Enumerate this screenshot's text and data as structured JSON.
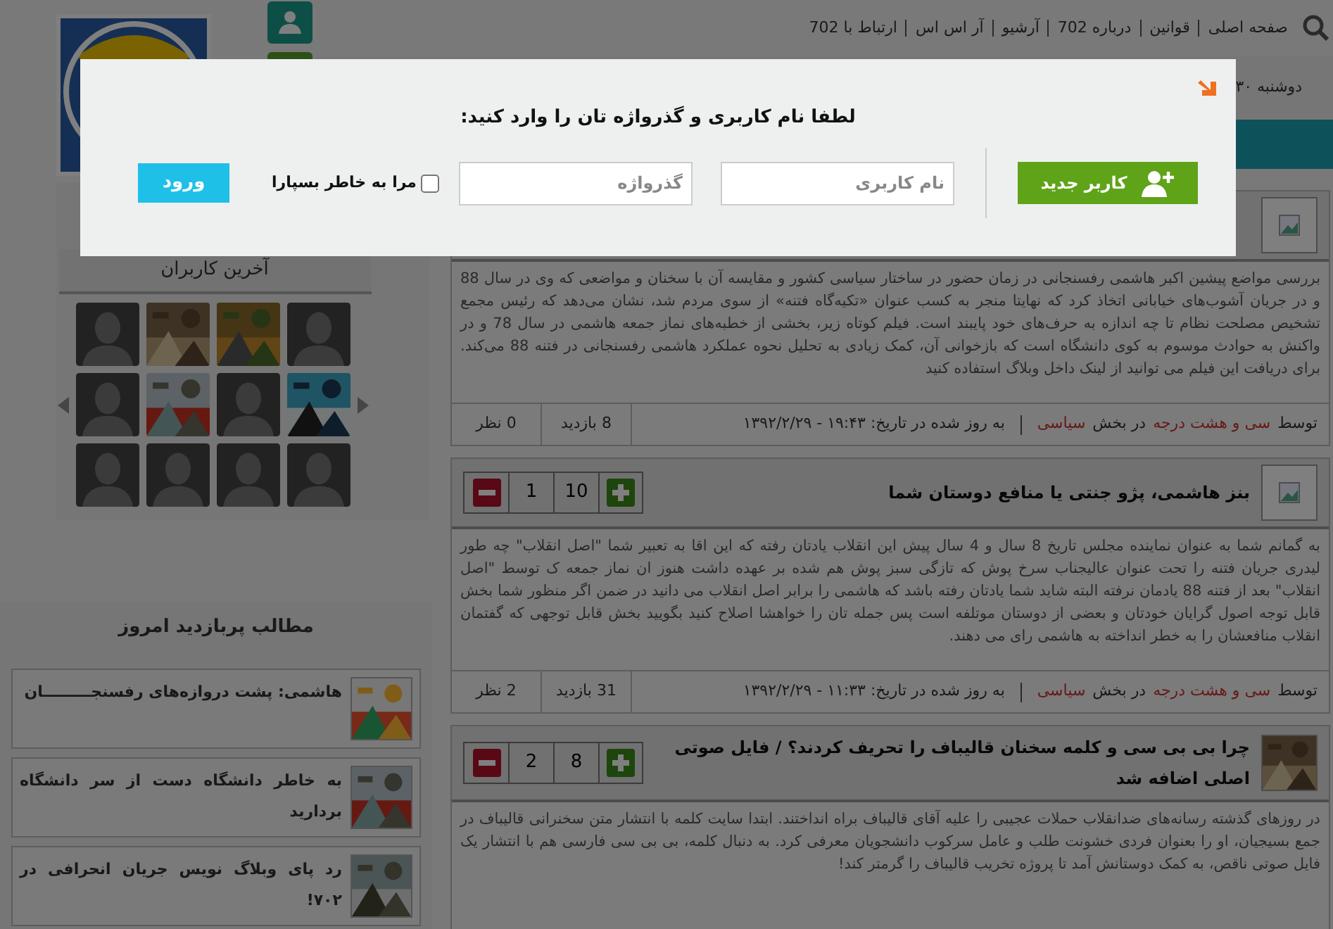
{
  "nav": {
    "links": [
      "صفحه اصلی",
      "قوانین",
      "درباره 702",
      "آرشیو",
      "آر اس اس",
      "ارتباط با 702"
    ]
  },
  "date": "دوشنبه ۳۰",
  "login_dialog": {
    "title": "لطفا نام کاربری و گذرواژه تان را وارد کنید:",
    "new_user_button": "کاربر جدید",
    "username": {
      "placeholder": "نام کاربری"
    },
    "password": {
      "placeholder": "گذرواژه"
    },
    "remember": {
      "label": "مرا به خاطر بسپارا",
      "checked": false
    },
    "login_button": "ورود"
  },
  "latest_users": {
    "title": "آخرین کاربران",
    "tiles": [
      {
        "kind": "avatar"
      },
      {
        "kind": "picture"
      },
      {
        "kind": "picture"
      },
      {
        "kind": "avatar"
      },
      {
        "kind": "avatar"
      },
      {
        "kind": "picture"
      },
      {
        "kind": "avatar"
      },
      {
        "kind": "picture"
      },
      {
        "kind": "avatar"
      },
      {
        "kind": "avatar"
      },
      {
        "kind": "avatar"
      },
      {
        "kind": "avatar"
      }
    ]
  },
  "popular": {
    "title": "مطالب پربازدید امروز",
    "items": [
      {
        "title": "هاشمی: پشت دروازه‌های رفسنجـــــــــان"
      },
      {
        "title": "به خاطر دانشگاه دست از سر دانشگاه بردارید"
      },
      {
        "title": "رد پای وبلاگ نویس جریان انحرافی در ۷۰۲!"
      }
    ]
  },
  "posts": [
    {
      "thumb": {
        "kind": "broken"
      },
      "body": "بررسی مواضع پیشین اکبر هاشمی رفسنجانی در زمان حضور در ساختار سیاسی کشور و مقایسه آن با سخنان و مواضعی که وی در سال 88 و در جریان آشوب‌های خیابانی اتخاذ کرد که نهایتا منجر به کسب عنوان «تکیه‌گاه فتنه» از سوی مردم شد، نشان می‌دهد که رئیس مجمع تشخیص مصلحت نظام تا چه اندازه به حرف‌های خود پایبند است. فیلم کوتاه زیر، بخشی از خطبه‌های نماز جمعه هاشمی در سال 78 و در واکنش به حوادث موسوم به کوی دانشگاه است که بازخوانی آن، کمک زیادی به تحلیل نحوه عملکرد هاشمی رفسنجانی در فتنه 88 می‌کند. برای دریافت این فیلم می توانید از لینک داخل وبلاگ استفاده کنید",
      "author_prefix": "توسط",
      "author": "سی و هشت درجه",
      "section_prefix": "در بخش",
      "section": "سیاسی",
      "updated": "به روز شده در تاریخ: ۱۹:۴۳ - ۱۳۹۲/۲/۲۹",
      "views": "8 بازدید",
      "comments": "0 نظر"
    },
    {
      "thumb": {
        "kind": "broken"
      },
      "title": "بنز هاشمی، پژو جنتی یا منافع دوستان شما",
      "votes_up": "10",
      "votes_down": "1",
      "body": "به گمانم شما به عنوان نماینده مجلس تاریخ 8 سال و 4 سال پیش این انقلاب یادتان رفته که این اقا به تعبیر شما \"اصل انقلاب\" چه طور لیدری جریان فتنه را تحت عنوان عالیجناب سرخ پوش که تازگی سبز پوش هم شده بر عهده داشت هنوز ان نماز جمعه ک توسط \"اصل انقلاب\" بعد از فتنه 88 یادمان نرفته البته شاید شما یادتان رفته باشد که هاشمی را برابر اصل انقلاب می دانید در ضمن اگر منظور شما بخش قابل توجه اصول گرایان خودتان و بعضی از دوستان موتلفه است پس جمله تان را خواهشا اصلاح کنید بگویید بخش قابل توجهی که گفتمان انقلاب منافعشان را به خطر انداخته به هاشمی رای می دهند.",
      "author_prefix": "توسط",
      "author": "سی و هشت درجه",
      "section_prefix": "در بخش",
      "section": "سیاسی",
      "updated": "به روز شده در تاریخ: ۱۱:۳۳ - ۱۳۹۲/۲/۲۹",
      "views": "31 بازدید",
      "comments": "2 نظر"
    },
    {
      "thumb": {
        "kind": "picture"
      },
      "title": "چرا بی بی سی و کلمه سخنان قالیباف را تحریف کردند؟ / فایل صوتی اصلی اضافه شد",
      "votes_up": "8",
      "votes_down": "2",
      "body": "در روزهای گذشته رسانه‌های ضدانقلاب حملات عجیبی را علیه آقای قالیباف براه انداختند. ابتدا سایت کلمه با انتشار متن سخنرانی قالیباف در جمع بسیجیان، او را بعنوان فردی خشونت طلب و عامل سرکوب دانشجویان معرفی کرد. به دنبال کلمه، بی بی سی فارسی هم با انتشار یک فایل صوتی ناقص، به کمک دوستانش آمد تا پروژه تخریب قالیباف را گرمتر کند!"
    }
  ]
}
